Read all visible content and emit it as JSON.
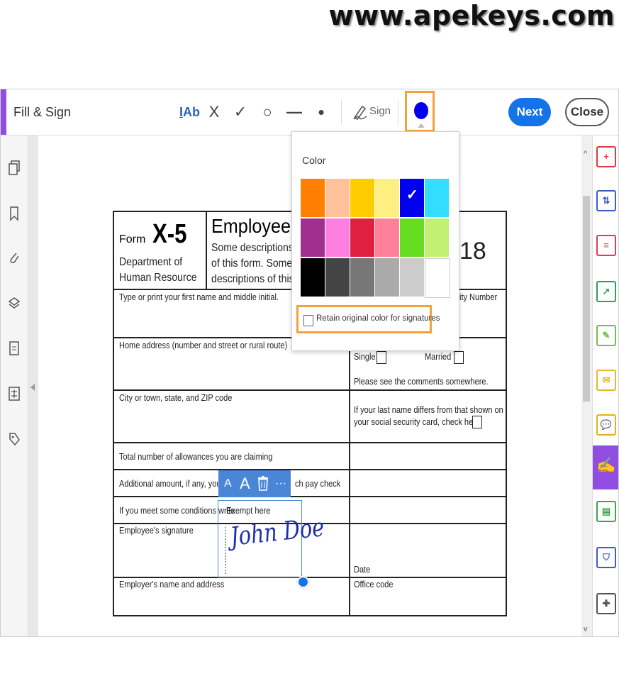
{
  "watermark": "www.apekeys.com",
  "toolbar": {
    "title": "Fill & Sign",
    "tools": [
      {
        "name": "add-text",
        "glyph": "IAb"
      },
      {
        "name": "cross-mark",
        "glyph": "X"
      },
      {
        "name": "check-mark",
        "glyph": "✓"
      },
      {
        "name": "circle",
        "glyph": "○"
      },
      {
        "name": "line",
        "glyph": "—"
      },
      {
        "name": "dot",
        "glyph": "•"
      }
    ],
    "sign_label": "Sign",
    "current_color": "#0000ee",
    "next_label": "Next",
    "close_label": "Close"
  },
  "color_popup": {
    "title": "Color",
    "selected": "#0000ee",
    "swatches": [
      "#ff7f00",
      "#ffc199",
      "#ffcc00",
      "#ffee80",
      "#0000ee",
      "#33ddff",
      "#a0308f",
      "#ff7fe0",
      "#e02040",
      "#ff8099",
      "#66dd22",
      "#c2f070",
      "#000000",
      "#444444",
      "#777777",
      "#aaaaaa",
      "#cccccc",
      "#ffffff"
    ],
    "retain_label": "Retain original color for signatures",
    "retain_checked": false
  },
  "form": {
    "form_label": "Form",
    "form_number": "X-5",
    "dept_line1": "Department of",
    "dept_line2": "Human Resource",
    "title": "Employee x",
    "desc_line1": "Some descriptions o",
    "desc_line2": "of this form. Some d",
    "desc_line3": "descriptions of this f",
    "year_fragment": "18",
    "name_label": "Type or print your first name and middle initial.",
    "ssn_fragment": "ity Number",
    "address_label": "Home address (number and street or rural route)",
    "single_label": "Single",
    "married_label": "Married",
    "comments_note": "Please see the comments somewhere.",
    "city_label": "City or town, state, and ZIP code",
    "lastname_note_line1": "If your last name differs from that shown on",
    "lastname_note_line2": "your social security card, check here",
    "allowances_label": "Total number of allowances you are claiming",
    "additional_label_start": "Additional amount, if any, you w",
    "additional_label_end": "ch pay check",
    "exempt_label": "If you meet some conditions write \"Exempt here\"",
    "exempt_label_visible": "If you meet some conditions write",
    "exempt_value": "Exempt here",
    "signature_label": "Employee's signature",
    "signature_value": "John Doe",
    "date_label": "Date",
    "employer_label": "Employer's name and address",
    "office_label": "Office code"
  },
  "context_toolbar": {
    "smaller_text": "A",
    "larger_text": "A",
    "more": "···"
  },
  "right_rail": [
    {
      "name": "create-pdf-icon",
      "color": "#e03a3a",
      "glyph": "+"
    },
    {
      "name": "combine-files-icon",
      "color": "#3b5cc9",
      "glyph": "⇅"
    },
    {
      "name": "organize-pages-icon",
      "color": "#e03a5a",
      "glyph": "≡"
    },
    {
      "name": "export-pdf-icon",
      "color": "#2f9e5e",
      "glyph": "↗"
    },
    {
      "name": "edit-pdf-icon",
      "color": "#6cc24a",
      "glyph": "✎"
    },
    {
      "name": "request-signature-icon",
      "color": "#e8b631",
      "glyph": "✉"
    },
    {
      "name": "comment-icon",
      "color": "#e3b21a",
      "glyph": "💬"
    },
    {
      "name": "fill-sign-icon",
      "color": "#ffffff",
      "glyph": "✍"
    },
    {
      "name": "print-production-icon",
      "color": "#3aa845",
      "glyph": "▤"
    },
    {
      "name": "protect-icon",
      "color": "#3b5cc9",
      "glyph": "⛉"
    },
    {
      "name": "more-tools-icon",
      "color": "#555555",
      "glyph": "✚"
    }
  ]
}
